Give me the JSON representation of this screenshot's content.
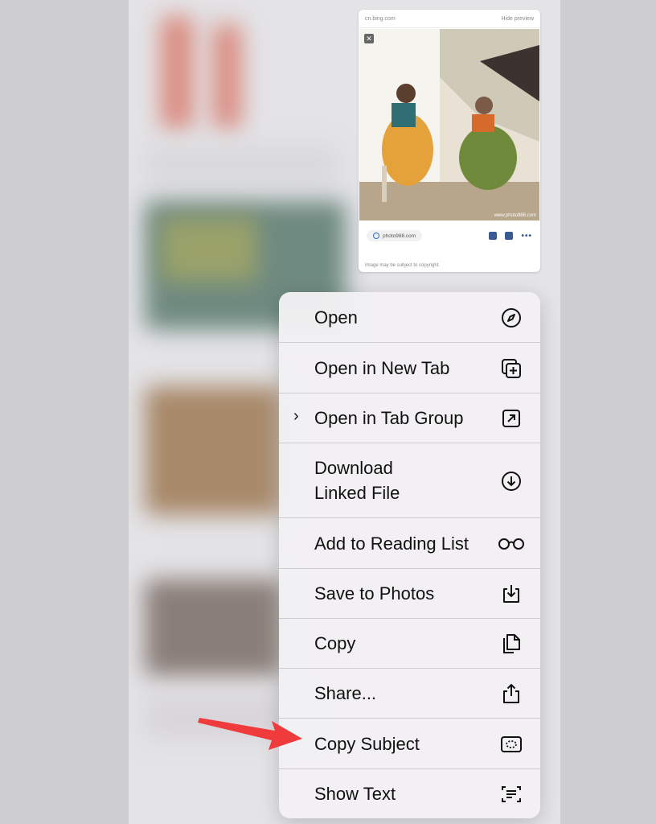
{
  "preview": {
    "domain": "cn.bing.com",
    "hide_label": "Hide preview",
    "close_glyph": "✕",
    "watermark": "www.photo988.com",
    "source": "photo988.com",
    "copyright": "Image may be subject to copyright."
  },
  "menu": {
    "items": [
      {
        "label": "Open",
        "icon": "compass-icon"
      },
      {
        "label": "Open in New Tab",
        "icon": "plus-square-icon"
      },
      {
        "label": "Open in Tab Group",
        "icon": "arrow-square-icon",
        "chevron": "›"
      },
      {
        "label": "Download\nLinked File",
        "icon": "download-circle-icon"
      },
      {
        "label": "Add to Reading List",
        "icon": "glasses-icon"
      },
      {
        "label": "Save to Photos",
        "icon": "save-tray-icon"
      },
      {
        "label": "Copy",
        "icon": "copy-doc-icon"
      },
      {
        "label": "Share...",
        "icon": "share-icon"
      },
      {
        "label": "Copy Subject",
        "icon": "copy-subject-icon"
      },
      {
        "label": "Show Text",
        "icon": "live-text-icon"
      }
    ]
  },
  "colors": {
    "arrow": "#ef3b3b",
    "menu_bg": "#f2f1f3"
  }
}
